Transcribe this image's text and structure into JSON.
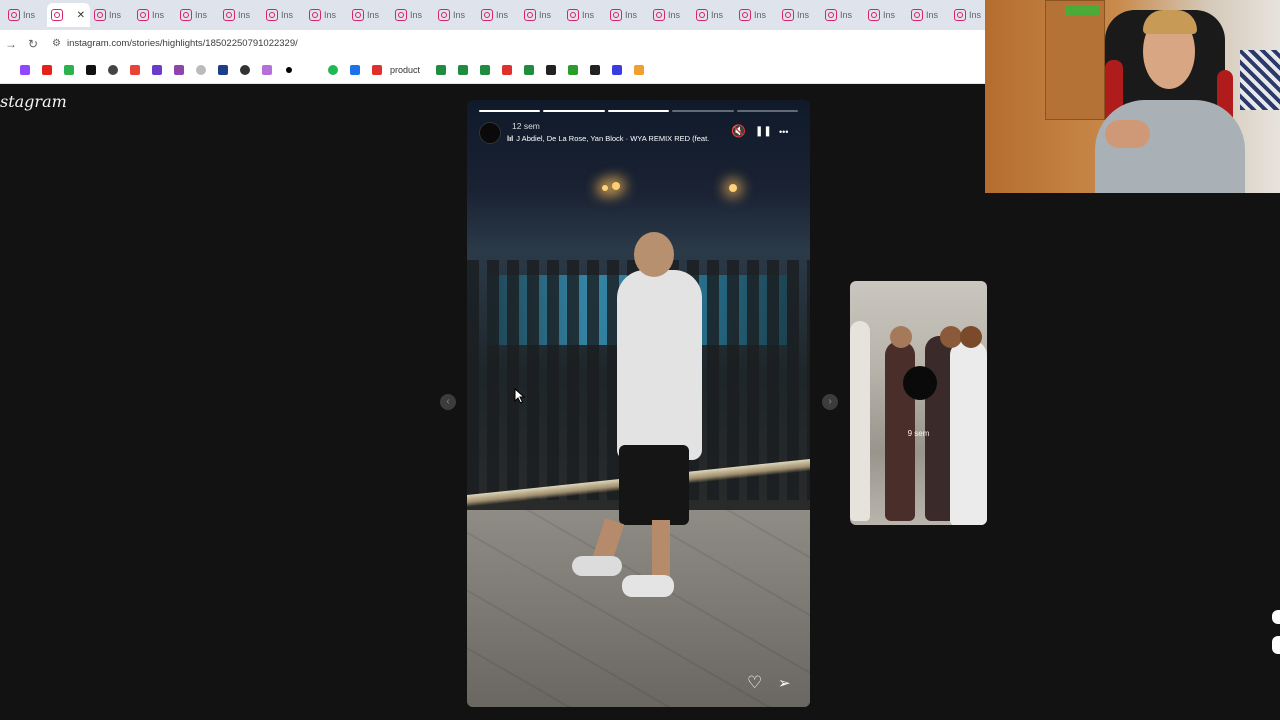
{
  "browser": {
    "tab_label": "Ins",
    "tab_count": 23,
    "active_tab_index": 1,
    "close_glyph": "✕",
    "url": "instagram.com/stories/highlights/18502250791022329/"
  },
  "bookmarks": {
    "icons": [
      "twitch-icon",
      "youtube-icon",
      "app-icon",
      "tiktok-icon",
      "chatgpt-icon",
      "gmail-icon",
      "app-icon",
      "app-icon",
      "app-icon",
      "paypal-icon",
      "whatsapp-icon",
      "app-icon",
      "app-icon",
      "app-icon",
      "spotify-icon",
      "prime-icon"
    ],
    "product_label": "product"
  },
  "instagram": {
    "logo_text": "stagram"
  },
  "story": {
    "time": "12 sem",
    "song": "J Abdiel, De La Rose, Yan Block · WYA REMIX RED (feat.",
    "song_bars": "lıl",
    "progress_segments": 5,
    "progress_done": 3,
    "mute_icon": "🔇",
    "pause_icon": "❚❚",
    "more_icon": "•••",
    "like_icon": "♡",
    "send_icon": "➢"
  },
  "next_story": {
    "time": "9 sem"
  },
  "nav": {
    "prev": "‹",
    "next": "›"
  },
  "colors": {
    "page_bg": "#121212",
    "tab_bar": "#dfe3eb",
    "instagram_pink": "#d6246e"
  }
}
